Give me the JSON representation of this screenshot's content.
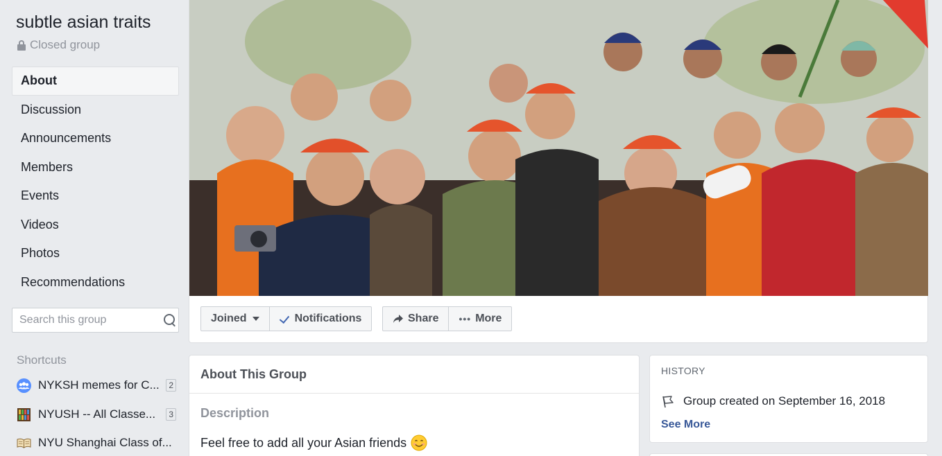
{
  "group": {
    "name": "subtle asian traits",
    "privacy": "Closed group"
  },
  "nav": {
    "items": [
      {
        "label": "About",
        "active": true
      },
      {
        "label": "Discussion"
      },
      {
        "label": "Announcements"
      },
      {
        "label": "Members"
      },
      {
        "label": "Events"
      },
      {
        "label": "Videos"
      },
      {
        "label": "Photos"
      },
      {
        "label": "Recommendations"
      }
    ]
  },
  "search": {
    "placeholder": "Search this group",
    "value": ""
  },
  "shortcuts": {
    "title": "Shortcuts",
    "items": [
      {
        "label": "NYKSH memes for C...",
        "count": "2",
        "icon": "group-icon"
      },
      {
        "label": "NYUSH -- All Classe...",
        "count": "3",
        "icon": "bookshelf-icon"
      },
      {
        "label": "NYU Shanghai Class of...",
        "count": "",
        "icon": "book-icon"
      }
    ]
  },
  "actions": {
    "joined": "Joined",
    "notifications": "Notifications",
    "share": "Share",
    "more": "More"
  },
  "about": {
    "title": "About This Group",
    "description_label": "Description",
    "description_text": "Feel free to add all your Asian friends"
  },
  "history": {
    "label": "HISTORY",
    "created": "Group created on September 16, 2018",
    "see_more": "See More"
  },
  "colors": {
    "link": "#385898",
    "accent": "#4267b2",
    "background": "#e9ebee"
  }
}
